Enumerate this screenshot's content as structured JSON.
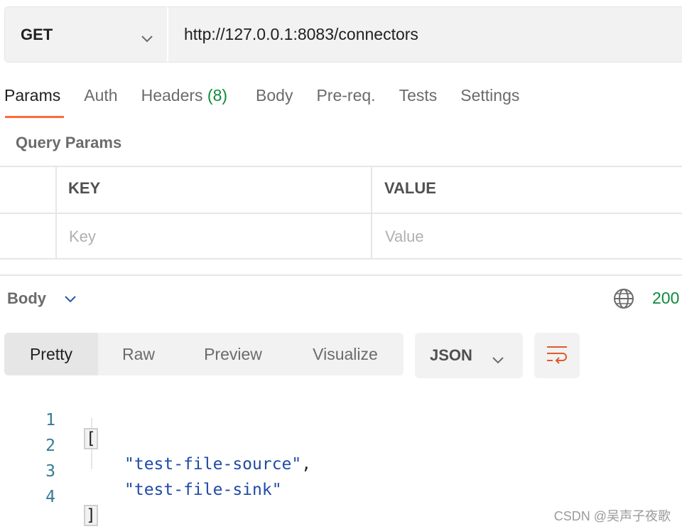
{
  "request": {
    "method": "GET",
    "url": "http://127.0.0.1:8083/connectors"
  },
  "tabs": [
    {
      "label": "Params",
      "count": "",
      "active": true
    },
    {
      "label": "Auth",
      "count": ""
    },
    {
      "label": "Headers",
      "count": "(8)"
    },
    {
      "label": "Body",
      "count": ""
    },
    {
      "label": "Pre-req.",
      "count": ""
    },
    {
      "label": "Tests",
      "count": ""
    },
    {
      "label": "Settings",
      "count": ""
    }
  ],
  "query_params": {
    "title": "Query Params",
    "headers": {
      "key": "KEY",
      "value": "VALUE"
    },
    "placeholders": {
      "key": "Key",
      "value": "Value"
    }
  },
  "response": {
    "body_label": "Body",
    "status": "200",
    "view_modes": [
      "Pretty",
      "Raw",
      "Preview",
      "Visualize"
    ],
    "active_view": "Pretty",
    "format": "JSON",
    "lines": [
      {
        "num": "1",
        "text": "["
      },
      {
        "num": "2",
        "text": "\"test-file-source\","
      },
      {
        "num": "3",
        "text": "\"test-file-sink\""
      },
      {
        "num": "4",
        "text": "]"
      }
    ]
  },
  "watermark": "CSDN @吴声子夜歌",
  "colors": {
    "accent": "#ff6c37",
    "status_ok": "#0f8a3a",
    "json_string": "#1f4aa6",
    "line_number": "#357a97"
  },
  "icons": [
    "chevron-down-icon",
    "globe-icon",
    "wrap-lines-icon"
  ]
}
